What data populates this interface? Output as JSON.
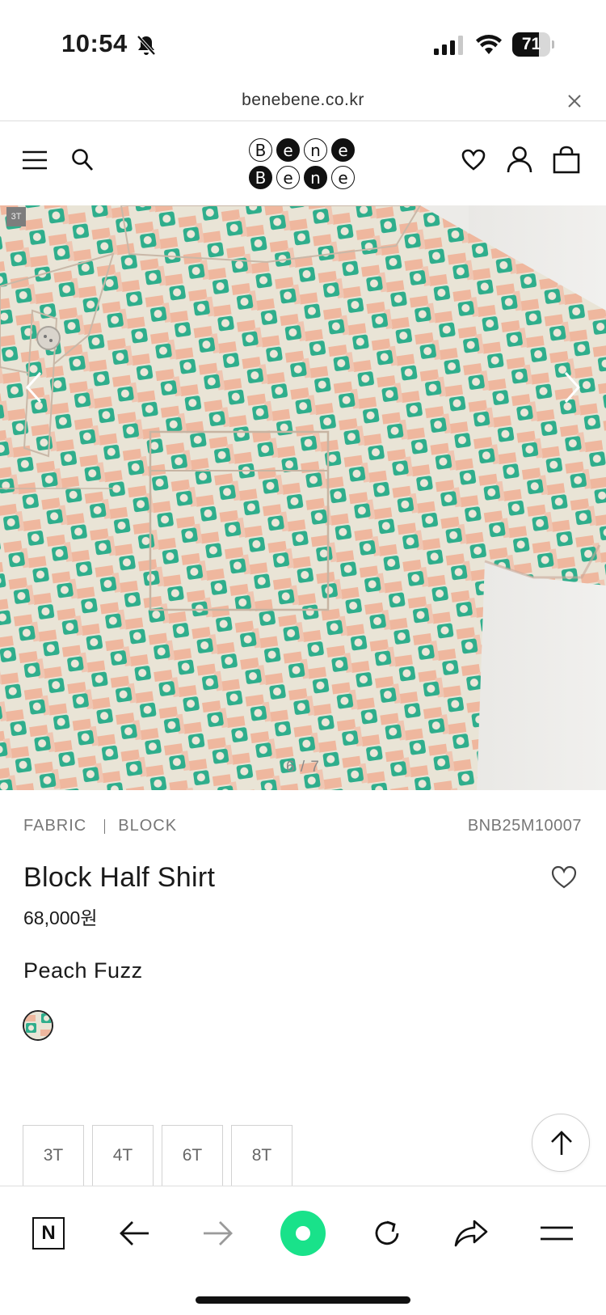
{
  "status_bar": {
    "time": "10:54",
    "battery": "71",
    "battery_level": 0.71
  },
  "browser": {
    "url": "benebene.co.kr"
  },
  "header": {
    "logo_top": [
      "B",
      "e",
      "n",
      "e"
    ],
    "logo_bottom": [
      "B",
      "e",
      "n",
      "e"
    ]
  },
  "gallery": {
    "counter": "6 / 7",
    "tag": "3T"
  },
  "product": {
    "breadcrumb": [
      "FABRIC",
      "BLOCK"
    ],
    "code": "BNB25M10007",
    "title": "Block Half Shirt",
    "price": "68,000원",
    "color": "Peach Fuzz",
    "sizes": [
      "3T",
      "4T",
      "6T",
      "8T"
    ]
  },
  "toolbar": {
    "n_label": "N"
  },
  "colors": {
    "accent_green": "#19e28a",
    "fabric_peach": "#efb79e",
    "fabric_green": "#2fae8c"
  }
}
